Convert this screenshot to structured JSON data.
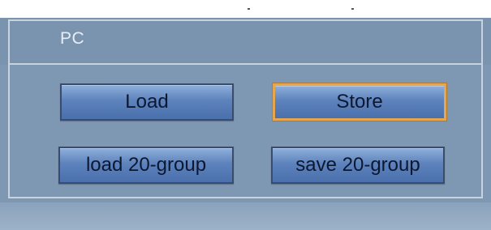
{
  "group": {
    "title": "PC"
  },
  "buttons": {
    "load_label": "Load",
    "store_label": "Store",
    "load_group_label": "load 20-group",
    "save_group_label": "save 20-group"
  },
  "colors": {
    "panel_bg": "#7e97b2",
    "frame_line": "#c9d3de",
    "button_fill": "#5d82bc",
    "focus_border": "#e8a64c"
  }
}
